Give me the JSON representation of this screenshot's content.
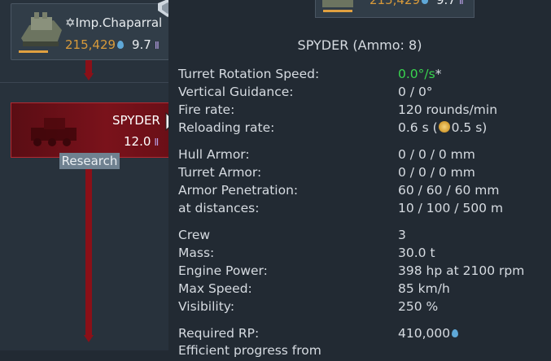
{
  "tree": {
    "top_vehicle": {
      "name": "✡Imp.Chaparral",
      "rp": "215,429",
      "br": "9.7"
    },
    "spyder": {
      "name": "SPYDER",
      "br": "12.0",
      "research_label": "Research"
    }
  },
  "panel": {
    "top_card": {
      "rp": "215,429",
      "br": "9.7"
    },
    "title": "SPYDER (Ammo: 8)",
    "turret_rotation": {
      "label": "Turret Rotation Speed:",
      "value": "0.0°/s",
      "suffix": "*"
    },
    "vertical_guidance": {
      "label": "Vertical Guidance:",
      "value": "0 / 0°"
    },
    "fire_rate": {
      "label": "Fire rate:",
      "value": "120 rounds/min"
    },
    "reloading_rate": {
      "label": "Reloading rate:",
      "value_pre": "0.6 s (",
      "value_post": "0.5 s)"
    },
    "hull_armor": {
      "label": "Hull Armor:",
      "value": "0 / 0 / 0 mm"
    },
    "turret_armor": {
      "label": "Turret Armor:",
      "value": "0 / 0 / 0 mm"
    },
    "armor_penetration": {
      "label": "Armor Penetration:",
      "value": "60 / 60 / 60 mm"
    },
    "at_distances": {
      "label": "at distances:",
      "value": "10 / 100 / 500 m"
    },
    "crew": {
      "label": "Crew",
      "value": "3"
    },
    "mass": {
      "label": "Mass:",
      "value": "30.0 t"
    },
    "engine_power": {
      "label": "Engine Power:",
      "value": "398 hp at 2100 rpm"
    },
    "max_speed": {
      "label": "Max Speed:",
      "value": "85 km/h"
    },
    "visibility": {
      "label": "Visibility:",
      "value": "250 %"
    },
    "required_rp": {
      "label": "Required RP:",
      "value": "410,000"
    },
    "efficient_progress": {
      "label": "Efficient progress from"
    }
  },
  "icons": {
    "rp": "rp-drop-icon",
    "br": "battle-rating-icon",
    "reload_bonus": "crew-skill-sun-icon",
    "cursor": "mouse-pointer-icon"
  },
  "colors": {
    "tree_line": "#8a1018",
    "spyder_card": "#7a121b",
    "rp_text": "#d89a3a",
    "stat_highlight": "#39d44f"
  }
}
